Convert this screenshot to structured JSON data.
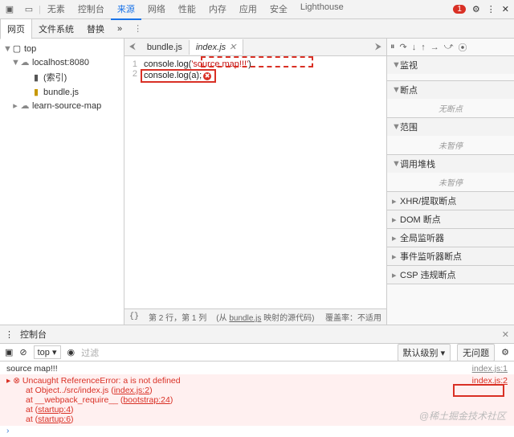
{
  "topbar": {
    "tabs": [
      "无素",
      "控制台",
      "来源",
      "网络",
      "性能",
      "内存",
      "应用",
      "安全",
      "Lighthouse"
    ],
    "active": 2,
    "error_count": "1"
  },
  "sub_tabs": {
    "items": [
      "网页",
      "文件系统",
      "替换"
    ],
    "active": 0
  },
  "navigator": {
    "items": [
      {
        "label": "top",
        "icon": "▢",
        "depth": 0,
        "twist": "▼"
      },
      {
        "label": "localhost:8080",
        "icon": "☁",
        "depth": 1,
        "twist": "▼"
      },
      {
        "label": "(索引)",
        "icon": "▮",
        "depth": 2,
        "twist": ""
      },
      {
        "label": "bundle.js",
        "icon": "▮",
        "depth": 2,
        "twist": ""
      },
      {
        "label": "learn-source-map",
        "icon": "☁",
        "depth": 1,
        "twist": "▸"
      }
    ]
  },
  "file_tabs": {
    "items": [
      {
        "label": "bundle.js",
        "active": false
      },
      {
        "label": "index.js",
        "active": true
      }
    ]
  },
  "code": {
    "lines": [
      {
        "n": "1",
        "text": "console.log('source map!!!')",
        "str": true
      },
      {
        "n": "2",
        "text": "console.log(a);",
        "err": true
      }
    ]
  },
  "editor_status": {
    "braces": "{}",
    "pos": "第 2 行，第 1 列",
    "mapped_prefix": "(从 ",
    "mapped_link": "bundle.js",
    "mapped_suffix": " 映射的源代码)",
    "coverage": "覆盖率：不适用"
  },
  "sidebar": {
    "controls": [
      "⏸",
      "⟳",
      "↓",
      "↑",
      "→",
      "⤴",
      "•"
    ],
    "sections": [
      {
        "label": "监视",
        "open": true,
        "body": ""
      },
      {
        "label": "断点",
        "open": true,
        "body": "无断点"
      },
      {
        "label": "范围",
        "open": true,
        "body": "未暂停"
      },
      {
        "label": "调用堆栈",
        "open": true,
        "body": "未暂停"
      },
      {
        "label": "XHR/提取断点",
        "open": false
      },
      {
        "label": "DOM 断点",
        "open": false
      },
      {
        "label": "全局监听器",
        "open": false
      },
      {
        "label": "事件监听器断点",
        "open": false
      },
      {
        "label": "CSP 违规断点",
        "open": false
      }
    ]
  },
  "console": {
    "title": "控制台",
    "scope": "top",
    "filter_placeholder": "过滤",
    "level": "默认级别",
    "issues": "无问题",
    "log_msg": "source map!!!",
    "log_src": "index.js:1",
    "error": {
      "head": "Uncaught ReferenceError: a is not defined",
      "src": "index.js:2",
      "trace": [
        {
          "ctx": "at Object../src/index.js",
          "loc": "index.js:2"
        },
        {
          "ctx": "at __webpack_require__",
          "loc": "bootstrap:24"
        },
        {
          "ctx": "at ",
          "loc": "startup:4"
        },
        {
          "ctx": "at ",
          "loc": "startup:6"
        }
      ]
    }
  },
  "watermark": "@稀土掘金技术社区"
}
